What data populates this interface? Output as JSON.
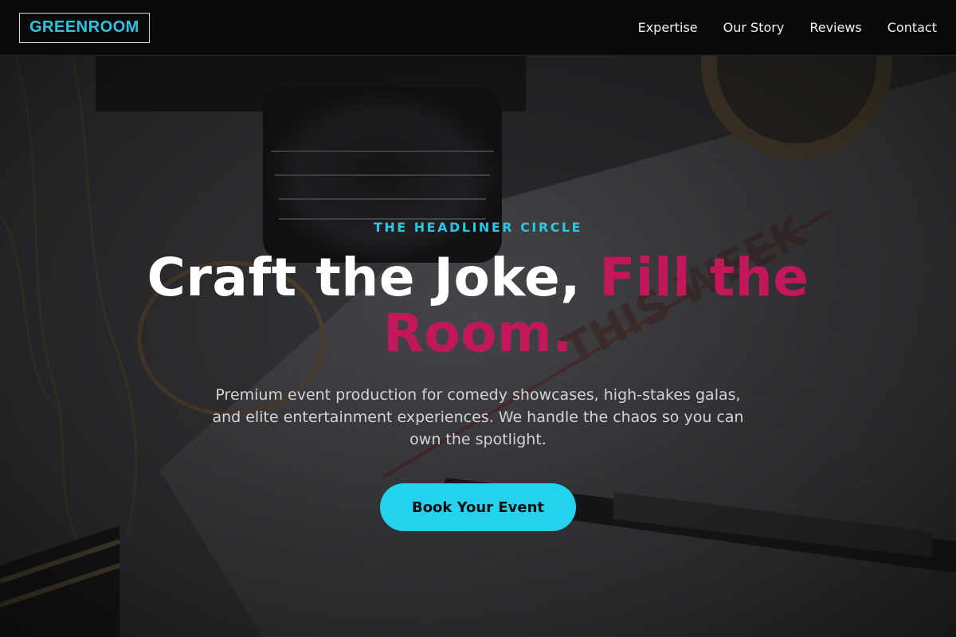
{
  "nav": {
    "logo": "GREENROOM",
    "links": [
      "Expertise",
      "Our Story",
      "Reviews",
      "Contact"
    ]
  },
  "hero": {
    "eyebrow": "THE HEADLINER CIRCLE",
    "headline_part1": "Craft the Joke, ",
    "headline_accent": "Fill the Room.",
    "subtext": "Premium event production for comedy showcases, high-stakes galas, and elite entertainment experiences. We handle the chaos so you can own the spotlight.",
    "cta_label": "Book Your Event"
  },
  "colors": {
    "accent_cyan": "#22d3ee",
    "accent_magenta": "#c2185b",
    "nav_bg": "#0a0a0b"
  }
}
